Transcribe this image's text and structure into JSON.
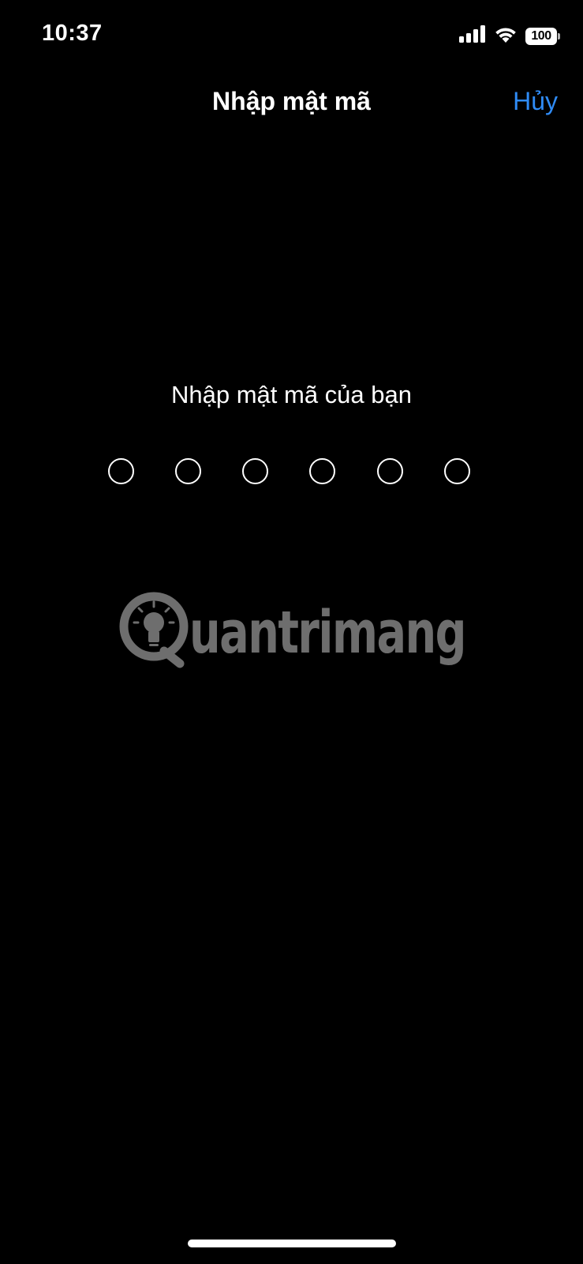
{
  "status_bar": {
    "time": "10:37",
    "battery_level": "100",
    "icons": [
      "cellular-signal-icon",
      "wifi-icon",
      "battery-icon"
    ]
  },
  "nav": {
    "title": "Nhập mật mã",
    "cancel_label": "Hủy"
  },
  "passcode": {
    "prompt": "Nhập mật mã của bạn",
    "digits_total": 6,
    "digits_entered": 0
  },
  "watermark": {
    "text": "Quantrimang",
    "icon": "lightbulb-icon"
  },
  "colors": {
    "background": "#000000",
    "text": "#ffffff",
    "accent": "#2f8bf5",
    "watermark": "#6e6e6e"
  }
}
